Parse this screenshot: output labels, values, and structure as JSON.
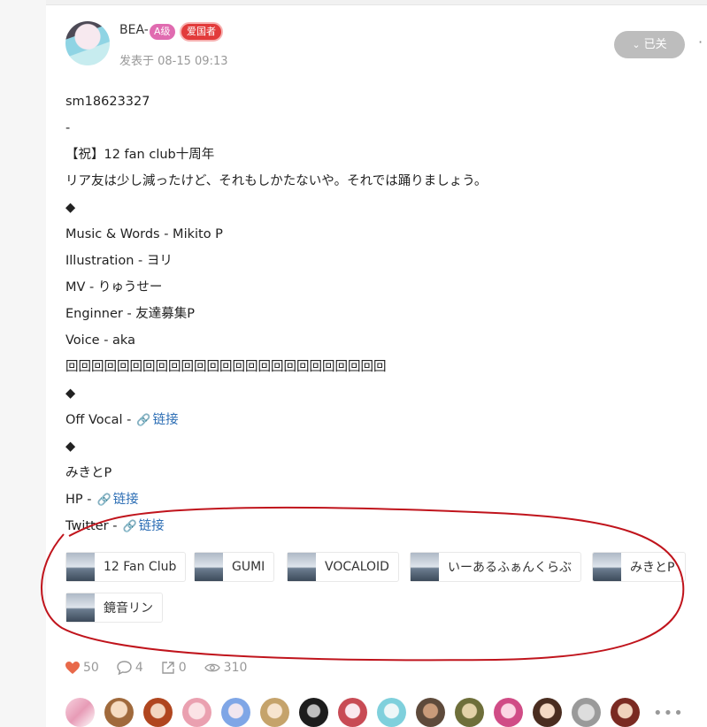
{
  "post": {
    "author": "BEA-",
    "level_badge": "A级",
    "love_badge": "爱国者",
    "date": "发表于 08-15 09:13",
    "follow_label": "已关",
    "lines": [
      "sm18623327",
      "-",
      "【祝】12 fan club十周年",
      "リア友は少し減ったけど、それもしかたないや。それでは踊りましょう。",
      "◆",
      "Music & Words - Mikito P",
      "Illustration - ヨリ",
      "MV - りゅうせー",
      "Enginner - 友達募集P",
      "Voice - aka",
      "回回回回回回回回回回回回回回回回回回回回回回回回回",
      "◆",
      "Off Vocal -",
      "◆",
      "みきとP",
      "HP -",
      "Twitter -"
    ],
    "link_label": "链接"
  },
  "tags": [
    "12 Fan Club",
    "GUMI",
    "VOCALOID",
    "いーあるふぁんくらぶ",
    "みきとP",
    "鏡音リン"
  ],
  "stats": {
    "likes": "50",
    "comments": "4",
    "shares": "0",
    "views": "310"
  },
  "colors": {
    "annotation": "#c0141c",
    "like": "#e8694a",
    "link": "#2e6fb5"
  }
}
